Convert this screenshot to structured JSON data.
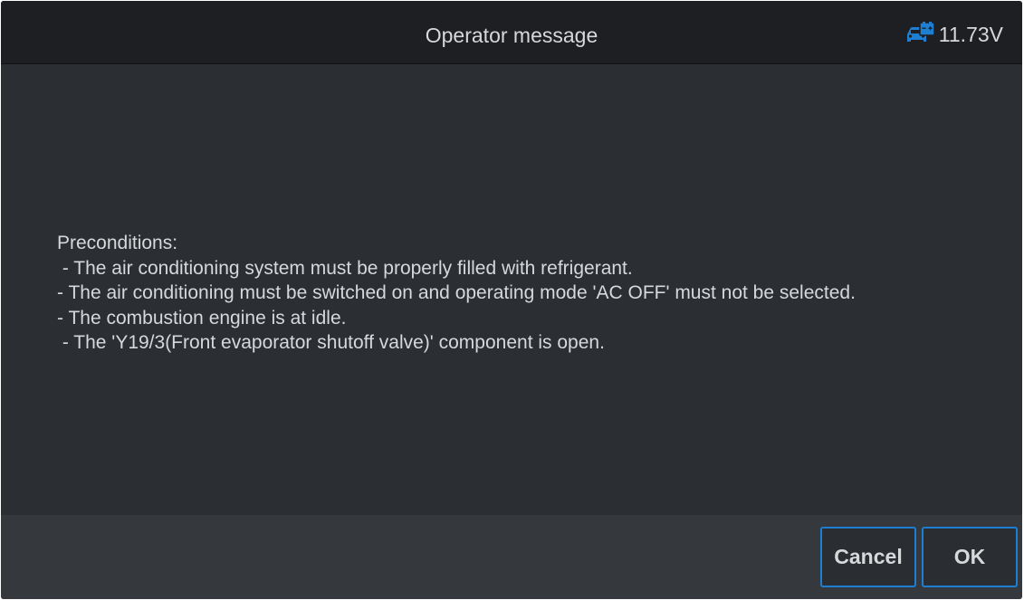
{
  "header": {
    "title": "Operator message",
    "voltage": "11.73V",
    "voltage_icon": "battery-car-icon"
  },
  "message": {
    "text": "Preconditions:\n - The air conditioning system must be properly filled with refrigerant.\n- The air conditioning must be switched on and operating mode 'AC OFF' must not be selected.\n- The combustion engine is at idle.\n - The 'Y19/3(Front evaporator shutoff valve)' component is open."
  },
  "footer": {
    "cancel_label": "Cancel",
    "ok_label": "OK"
  },
  "colors": {
    "accent": "#1e7fd2",
    "background": "#2b2e32",
    "header_background": "#1d1f22",
    "footer_background": "#35383c",
    "text": "#d6d8da"
  }
}
